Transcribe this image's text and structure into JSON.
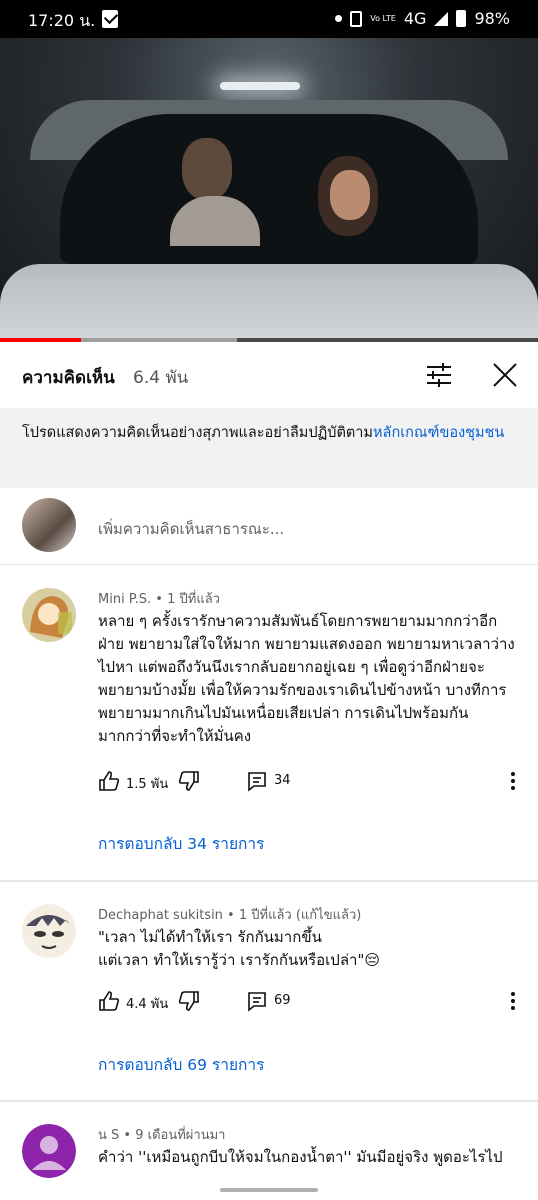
{
  "status_bar": {
    "time": "17:20 น.",
    "network": "4G",
    "volte": "Vo LTE",
    "battery": "98%"
  },
  "video": {
    "progress_played": 0.15,
    "progress_buffered": 0.44
  },
  "comments_header": {
    "title": "ความคิดเห็น",
    "count": "6.4 พัน"
  },
  "guidelines": {
    "text": "โปรดแสดงความคิดเห็นอย่างสุภาพและอย่าลืมปฏิบัติตาม",
    "link": "หลักเกณฑ์ของชุมชน"
  },
  "add_comment": {
    "placeholder": "เพิ่มความคิดเห็นสาธารณะ..."
  },
  "comments": [
    {
      "author": "Mini P.S.",
      "time": "1 ปีที่แล้ว",
      "text": "หลาย ๆ ครั้งเรารักษาความสัมพันธ์โดยการพยายามมากกว่าอีกฝ่าย พยายามใส่ใจให้มาก พยายามแสดงออก พยายามหาเวลาว่างไปหา แต่พอถึงวันนึงเรากลับอยากอยู่เฉย ๆ เพื่อดูว่าอีกฝ่ายจะพยายามบ้างมั้ย เพื่อให้ความรักของเราเดินไปข้างหน้า บางทีการพยายามมากเกินไปมันเหนื่อยเสียเปล่า การเดินไปพร้อมกันมากกว่าที่จะทำให้มั่นคง",
      "likes": "1.5 พัน",
      "reply_count": "34",
      "replies_label": "การตอบกลับ 34 รายการ"
    },
    {
      "author": "Dechaphat sukitsin",
      "time": "1 ปีที่แล้ว (แก้ไขแล้ว)",
      "text": "\"เวลา ไม่ได้ทำให้เรา รักกันมากขึ้น\nแต่เวลา ทำให้เรารู้ว่า เรารักกันหรือเปล่า\"😔",
      "likes": "4.4 พัน",
      "reply_count": "69",
      "replies_label": "การตอบกลับ 69 รายการ"
    },
    {
      "author": "น S",
      "time": "9 เดือนที่ผ่านมา",
      "text": "คำว่า ''เหมือนถูกบีบให้จมในกองน้ำตา'' มันมีอยู่จริง พูดอะไรไป"
    }
  ],
  "colors": {
    "link": "#065fd4",
    "progress": "#ff0000",
    "avatar3": "#8e24aa"
  },
  "icons": [
    "filter-icon",
    "close-icon",
    "like-icon",
    "dislike-icon",
    "reply-icon",
    "more-icon"
  ]
}
